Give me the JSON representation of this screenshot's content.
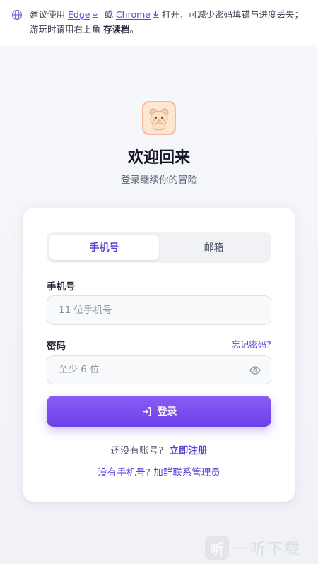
{
  "banner": {
    "prefix": "建议使用",
    "edge": "Edge",
    "or": "或",
    "chrome": "Chrome",
    "suffix": "打开，可减少密码填错与进度丢失；游玩时请用右上角",
    "save_label": "存读档",
    "end": "。",
    "icon": "globe-icon"
  },
  "header": {
    "title": "欢迎回来",
    "subtitle": "登录继续你的冒险",
    "logo_icon": "bear-icon"
  },
  "tabs": [
    {
      "label": "手机号",
      "active": true
    },
    {
      "label": "邮箱",
      "active": false
    }
  ],
  "form": {
    "phone_label": "手机号",
    "phone_placeholder": "11 位手机号",
    "password_label": "密码",
    "forgot_label": "忘记密码?",
    "password_placeholder": "至少 6 位",
    "login_label": "登录"
  },
  "footer": {
    "no_account": "还没有账号?",
    "register_link": "立即注册",
    "contact_link": "没有手机号? 加群联系管理员"
  },
  "watermark": {
    "badge": "听",
    "text": "一听下载"
  },
  "colors": {
    "accent": "#6d3fe8",
    "link": "#5b46d6"
  }
}
